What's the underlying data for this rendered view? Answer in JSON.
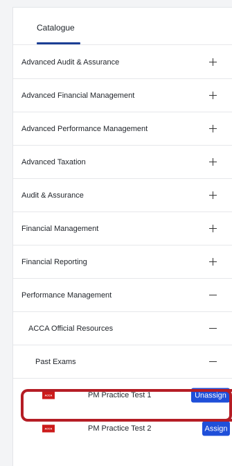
{
  "tabs": [
    {
      "label": "Catalogue",
      "active": true
    }
  ],
  "accent_color": "#1c3f94",
  "categories": [
    {
      "label": "Advanced Audit & Assurance",
      "expanded": false
    },
    {
      "label": "Advanced Financial Management",
      "expanded": false
    },
    {
      "label": "Advanced Performance Management",
      "expanded": false
    },
    {
      "label": "Advanced Taxation",
      "expanded": false
    },
    {
      "label": "Audit & Assurance",
      "expanded": false
    },
    {
      "label": "Financial Management",
      "expanded": false
    },
    {
      "label": "Financial Reporting",
      "expanded": false
    },
    {
      "label": "Performance Management",
      "expanded": true
    }
  ],
  "subcategory": {
    "label": "ACCA Official Resources",
    "expanded": true
  },
  "subsubcategory": {
    "label": "Past Exams",
    "expanded": true
  },
  "items": [
    {
      "logo_text": "ACCA",
      "title": "PM Practice Test 1",
      "action": "Unassign",
      "highlighted": true
    },
    {
      "logo_text": "ACCA",
      "title": "PM Practice Test 2",
      "action": "Assign",
      "highlighted": false
    }
  ],
  "colors": {
    "button": "#1f4fd9",
    "highlight": "#b51d25",
    "logo": "#cc1b1b"
  }
}
